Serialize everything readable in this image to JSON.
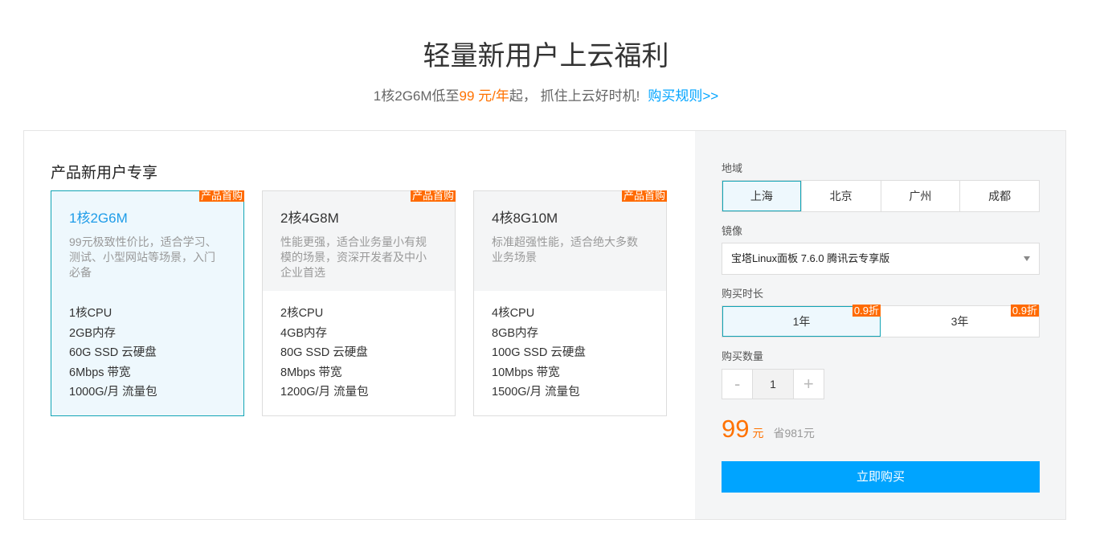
{
  "header": {
    "title": "轻量新用户上云福利",
    "subtitle_prefix": "1核2G6M低至",
    "subtitle_price": "99 元/年",
    "subtitle_suffix": "起， 抓住上云好时机!",
    "rules_link": "购买规则>>"
  },
  "products": {
    "section_title": "产品新用户专享",
    "cards": [
      {
        "ribbon": "产品首购",
        "name": "1核2G6M",
        "desc": "99元极致性价比，适合学习、测试、小型网站等场景，入门必备",
        "specs": [
          "1核CPU",
          "2GB内存",
          "60G SSD 云硬盘",
          "6Mbps 带宽",
          "1000G/月 流量包"
        ],
        "selected": true
      },
      {
        "ribbon": "产品首购",
        "name": "2核4G8M",
        "desc": "性能更强，适合业务量小有规模的场景，资深开发者及中小企业首选",
        "specs": [
          "2核CPU",
          "4GB内存",
          "80G SSD 云硬盘",
          "8Mbps 带宽",
          "1200G/月 流量包"
        ],
        "selected": false
      },
      {
        "ribbon": "产品首购",
        "name": "4核8G10M",
        "desc": "标准超强性能，适合绝大多数业务场景",
        "specs": [
          "4核CPU",
          "8GB内存",
          "100G SSD 云硬盘",
          "10Mbps 带宽",
          "1500G/月 流量包"
        ],
        "selected": false
      }
    ]
  },
  "config": {
    "region_label": "地域",
    "regions": [
      "上海",
      "北京",
      "广州",
      "成都"
    ],
    "selected_region": "上海",
    "image_label": "镜像",
    "image_value": "宝塔Linux面板 7.6.0 腾讯云专享版",
    "duration_label": "购买时长",
    "durations": [
      {
        "label": "1年",
        "discount": "0.9折"
      },
      {
        "label": "3年",
        "discount": "0.9折"
      }
    ],
    "selected_duration": "1年",
    "quantity_label": "购买数量",
    "quantity": "1",
    "minus": "-",
    "plus": "+",
    "price": "99",
    "price_unit": "元",
    "save_text": "省981元",
    "buy_label": "立即购买"
  },
  "colors": {
    "accent": "#00a4ff",
    "price": "#ff7200",
    "ribbon": "#ff6a00",
    "selected_border": "#12a4b5"
  }
}
